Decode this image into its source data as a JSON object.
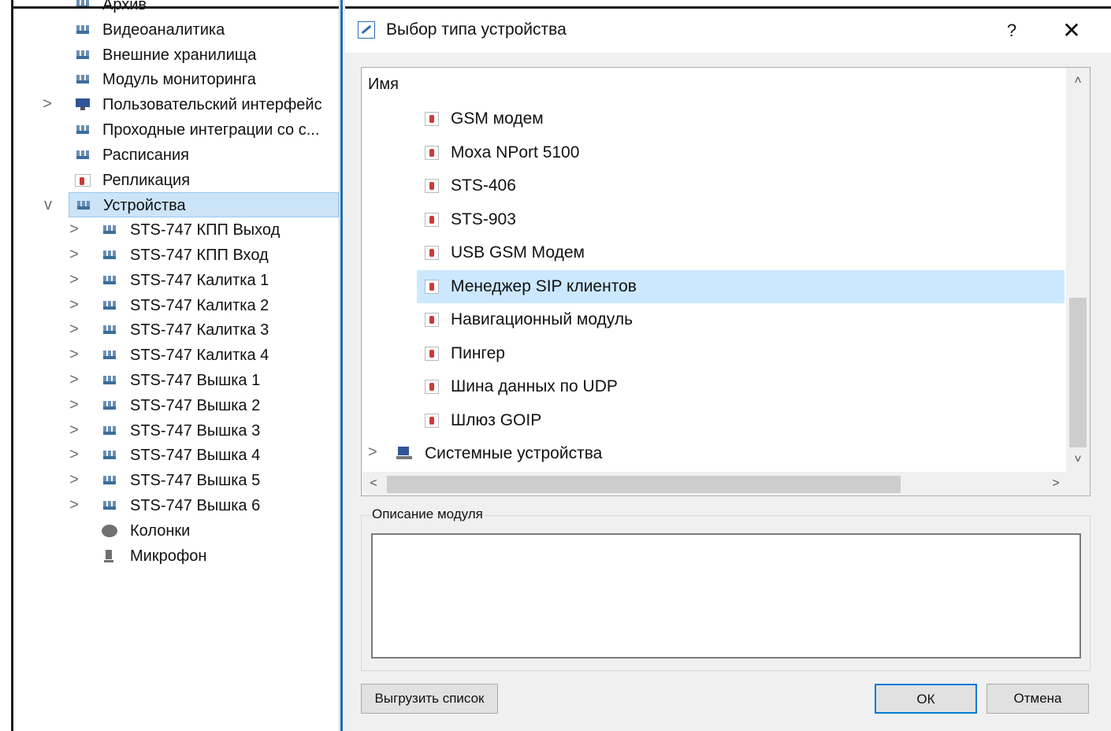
{
  "tree": {
    "items": [
      {
        "label": "Архив",
        "icon": "network-icon",
        "expander": ""
      },
      {
        "label": "Видеоаналитика",
        "icon": "network-icon",
        "expander": ""
      },
      {
        "label": "Внешние хранилища",
        "icon": "network-icon",
        "expander": ""
      },
      {
        "label": "Модуль мониторинга",
        "icon": "network-icon",
        "expander": ""
      },
      {
        "label": "Пользовательский интерфейс",
        "icon": "monitor-icon",
        "expander": ">"
      },
      {
        "label": "Проходные интеграции со с...",
        "icon": "network-icon",
        "expander": ""
      },
      {
        "label": "Расписания",
        "icon": "network-icon",
        "expander": ""
      },
      {
        "label": "Репликация",
        "icon": "device-icon",
        "expander": ""
      },
      {
        "label": "Устройства",
        "icon": "network-icon",
        "expander": "v"
      },
      {
        "label": "STS-747 КПП Выход",
        "icon": "network-icon",
        "expander": ">"
      },
      {
        "label": "STS-747 КПП Вход",
        "icon": "network-icon",
        "expander": ">"
      },
      {
        "label": "STS-747 Калитка 1",
        "icon": "network-icon",
        "expander": ">"
      },
      {
        "label": "STS-747 Калитка 2",
        "icon": "network-icon",
        "expander": ">"
      },
      {
        "label": "STS-747 Калитка 3",
        "icon": "network-icon",
        "expander": ">"
      },
      {
        "label": "STS-747 Калитка 4",
        "icon": "network-icon",
        "expander": ">"
      },
      {
        "label": "STS-747 Вышка 1",
        "icon": "network-icon",
        "expander": ">"
      },
      {
        "label": "STS-747 Вышка 2",
        "icon": "network-icon",
        "expander": ">"
      },
      {
        "label": "STS-747 Вышка 3",
        "icon": "network-icon",
        "expander": ">"
      },
      {
        "label": "STS-747 Вышка 4",
        "icon": "network-icon",
        "expander": ">"
      },
      {
        "label": "STS-747 Вышка 5",
        "icon": "network-icon",
        "expander": ">"
      },
      {
        "label": "STS-747 Вышка 6",
        "icon": "network-icon",
        "expander": ">"
      },
      {
        "label": "Колонки",
        "icon": "speaker-icon",
        "expander": ""
      },
      {
        "label": "Микрофон",
        "icon": "microphone-icon",
        "expander": ""
      }
    ],
    "selected": "Устройства"
  },
  "dialog": {
    "title": "Выбор типа устройства",
    "help": "?",
    "close": "✕",
    "column_header": "Имя",
    "devices": [
      "GSM модем",
      "Moxa NPort 5100",
      "STS-406",
      "STS-903",
      "USB GSM Модем",
      "Менеджер SIP клиентов",
      "Навигационный модуль",
      "Пингер",
      "Шина данных по UDP",
      "Шлюз GOIP"
    ],
    "selected_device": "Менеджер SIP клиентов",
    "system_group": {
      "label": "Системные устройства",
      "expander": ">"
    },
    "description_label": "Описание модуля",
    "description_text": "",
    "buttons": {
      "export": "Выгрузить список",
      "ok": "ОК",
      "cancel": "Отмена"
    },
    "scroll": {
      "up": "˄",
      "down": "˅",
      "left": "<",
      "right": ">"
    }
  },
  "colors": {
    "selection": "#cce8ff",
    "accent": "#0078d7",
    "dialog_bg": "#f0f0f0"
  }
}
